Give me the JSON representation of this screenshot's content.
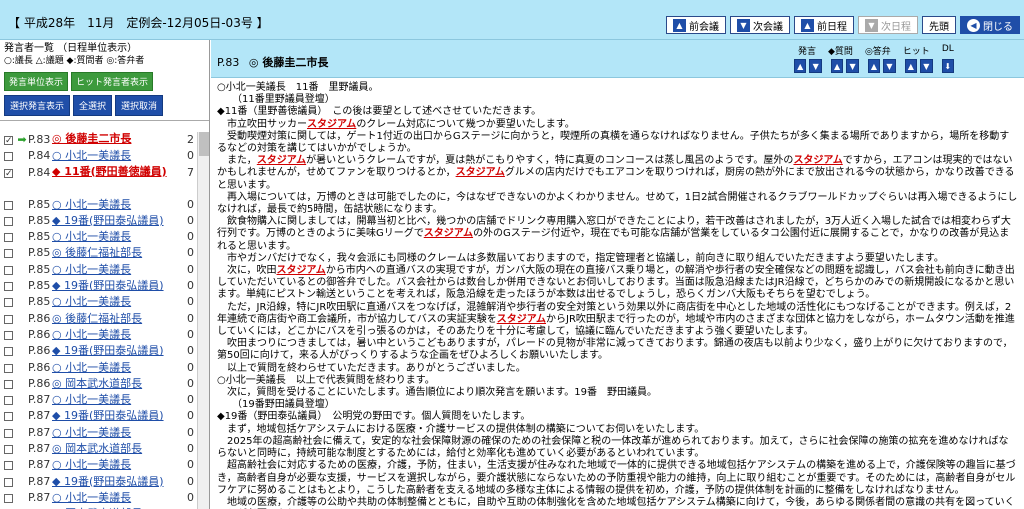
{
  "header": {
    "title": "【 平成28年　11月　定例会-12月05日-03号 】",
    "buttons": [
      {
        "label": "前会議",
        "icon": "up-arrow-icon",
        "state": "enabled"
      },
      {
        "label": "次会議",
        "icon": "down-arrow-icon",
        "state": "enabled"
      },
      {
        "label": "前日程",
        "icon": "up-arrow-icon",
        "state": "enabled"
      },
      {
        "label": "次日程",
        "icon": "down-arrow-icon",
        "state": "disabled"
      },
      {
        "label": "先頭",
        "icon": "",
        "state": "enabled"
      },
      {
        "label": "閉じる",
        "icon": "close-circle-icon",
        "state": "dark"
      }
    ]
  },
  "sidebar": {
    "heading": "発言者一覧 （日程単位表示）",
    "legend": "○:議長 △:議題 ◆:質問者 ◎:答弁者",
    "green_buttons": [
      "発言単位表示",
      "ヒット発言者表示"
    ],
    "blue_buttons": [
      "選択発言表示",
      "全選択",
      "選択取消"
    ],
    "rows": [
      {
        "checked": true,
        "current": true,
        "page": "P.83",
        "name": "◎ 後藤圭二市長",
        "count": "2",
        "highlight": true
      },
      {
        "checked": false,
        "current": false,
        "page": "P.84",
        "name": "○ 小北一美議長",
        "count": "0",
        "highlight": false
      },
      {
        "checked": true,
        "current": false,
        "page": "P.84",
        "name": "◆ 11番(野田善徳議員)",
        "count": "7",
        "highlight": true
      },
      {
        "checked": false,
        "current": false,
        "page": "P.85",
        "name": "○ 小北一美議長",
        "count": "0",
        "highlight": false
      },
      {
        "checked": false,
        "current": false,
        "page": "P.85",
        "name": "◆ 19番(野田泰弘議員)",
        "count": "0",
        "highlight": false
      },
      {
        "checked": false,
        "current": false,
        "page": "P.85",
        "name": "○ 小北一美議長",
        "count": "0",
        "highlight": false
      },
      {
        "checked": false,
        "current": false,
        "page": "P.85",
        "name": "◎ 後藤仁福祉部長",
        "count": "0",
        "highlight": false
      },
      {
        "checked": false,
        "current": false,
        "page": "P.85",
        "name": "○ 小北一美議長",
        "count": "0",
        "highlight": false
      },
      {
        "checked": false,
        "current": false,
        "page": "P.85",
        "name": "◆ 19番(野田泰弘議員)",
        "count": "0",
        "highlight": false
      },
      {
        "checked": false,
        "current": false,
        "page": "P.85",
        "name": "○ 小北一美議長",
        "count": "0",
        "highlight": false
      },
      {
        "checked": false,
        "current": false,
        "page": "P.86",
        "name": "◎ 後藤仁福祉部長",
        "count": "0",
        "highlight": false
      },
      {
        "checked": false,
        "current": false,
        "page": "P.86",
        "name": "○ 小北一美議長",
        "count": "0",
        "highlight": false
      },
      {
        "checked": false,
        "current": false,
        "page": "P.86",
        "name": "◆ 19番(野田泰弘議員)",
        "count": "0",
        "highlight": false
      },
      {
        "checked": false,
        "current": false,
        "page": "P.86",
        "name": "○ 小北一美議長",
        "count": "0",
        "highlight": false
      },
      {
        "checked": false,
        "current": false,
        "page": "P.86",
        "name": "◎ 岡本武水道部長",
        "count": "0",
        "highlight": false
      },
      {
        "checked": false,
        "current": false,
        "page": "P.87",
        "name": "○ 小北一美議長",
        "count": "0",
        "highlight": false
      },
      {
        "checked": false,
        "current": false,
        "page": "P.87",
        "name": "◆ 19番(野田泰弘議員)",
        "count": "0",
        "highlight": false
      },
      {
        "checked": false,
        "current": false,
        "page": "P.87",
        "name": "○ 小北一美議長",
        "count": "0",
        "highlight": false
      },
      {
        "checked": false,
        "current": false,
        "page": "P.87",
        "name": "◎ 岡本武水道部長",
        "count": "0",
        "highlight": false
      },
      {
        "checked": false,
        "current": false,
        "page": "P.87",
        "name": "○ 小北一美議長",
        "count": "0",
        "highlight": false
      },
      {
        "checked": false,
        "current": false,
        "page": "P.87",
        "name": "◆ 19番(野田泰弘議員)",
        "count": "0",
        "highlight": false
      },
      {
        "checked": false,
        "current": false,
        "page": "P.87",
        "name": "○ 小北一美議長",
        "count": "0",
        "highlight": false
      },
      {
        "checked": false,
        "current": false,
        "page": "P.87",
        "name": "◎ 岡本武水道部長",
        "count": "0",
        "highlight": false
      }
    ]
  },
  "main": {
    "page_label": "P.83",
    "speaker": "◎ 後藤圭二市長",
    "control_labels": [
      "発言",
      "◆質問",
      "◎答弁",
      "ヒット",
      "DL"
    ],
    "body": [
      "○小北一美議長　11番　里野議員。",
      "　　（11番里野議員登壇）",
      "◆11番（里野善徳議員）　この後は要望として述べさせていただきます。",
      "　市立吹田サッカー[スタジアム]のクレーム対応について幾つか要望いたします。",
      "　受動喫煙対策に関しては，ゲート1付近の出口からGステージに向かうと，喫煙所の真横を通らなければなりません。子供たちが多く集まる場所でありますから，場所を移動するなどの対策を講じてはいかがでしょうか。",
      "　また，[スタジアム]が暑いというクレームですが，夏は熱がこもりやすく，特に真夏のコンコースは蒸し風呂のようです。屋外の[スタジアム]ですから，エアコンは現実的ではないかもしれませんが，せめてファンを取りつけるとか，[スタジアム]グルメの店内だけでもエアコンを取りつければ，厨房の熱が外にまで放出される今の状態から，かなり改善できると思います。",
      "　再入場については，万博のときは可能でしたのに，今はなぜできないのかよくわかりません。せめて，1日2試合開催されるクラブワールドカップぐらいは再入場できるようにしなければ，最長で約5時間，缶詰状態になります。",
      "　飲食物購入に関しましては，開幕当初と比べ，幾つかの店舗でドリンク専用購入窓口ができたことにより，若干改善はされましたが，3万人近く入場した試合では相変わらず大行列です。万博のときのように美味Gリーグで[スタジアム]の外のGステージ付近や，現在でも可能な店舗が営業をしているタコ公園付近に展開することで，かなりの改善が見込まれると思います。",
      "　市やガンバだけでなく，我々会派にも同様のクレームは多数届いておりますので，指定管理者と協議し，前向きに取り組んでいただきますよう要望いたします。",
      "　次に，吹田[スタジアム]から市内への直通バスの実現ですが，ガンバ大阪の現在の直接バス乗り場と，の解消や歩行者の安全確保などの問題を認識し，バス会社も前向きに動き出していただいているとの御答弁でした。バス会社からは数台しか併用できないとお伺いしております。当面は阪急沿線またはJR沿線で，どちらかのみでの新規開設になるかと思います。単純にピストン輸送ということを考えれば，阪急沿線を走ったほうが本数は出せるでしょうし，恐らくガンバ大阪もそちらを望むでしょう。",
      "　ただ，JR沿線，特にJR吹田駅に直通バスをつなげば，混雑解消や歩行者の安全対策という効果以外に商店街を中心とした地域の活性化にもつなげることができます。例えば，2年連続で商店街や商工会議所，市が協力してバスの実証実験を[スタジアム]からJR吹田駅まで行ったのが，地域や市内のさまざまな団体と協力をしながら，ホームタウン活動を推進していくには，どこかにバスを引っ張るのかは，そのあたりを十分に考慮して，協議に臨んでいただきますよう強く要望いたします。",
      "　吹田まつりにつきましては，暑い中というこどもありますが，パレードの見物が非常に減ってきております。錦通の夜店も以前より少なく，盛り上がりに欠けておりますので，第50回に向けて，来る人がびっくりするような企画をぜひよろしくお願いいたします。",
      "　以上で質問を終わらせていただきます。ありがとうございました。",
      "○小北一美議長　以上で代表質問を終わります。",
      "　次に，質問を受けることにいたします。通告順位により順次発言を願います。19番　野田議員。",
      "　　（19番野田議員登壇）",
      "◆19番（野田泰弘議員）　公明党の野田です。個人質問をいたします。",
      "　まず，地域包括ケアシステムにおける医療・介護サービスの提供体制の構築についてお伺いをいたします。",
      "　2025年の超高齢社会に備えて，安定的な社会保障財源の確保のための社会保障と税の一体改革が進められております。加えて，さらに社会保障の施策の拡充を進めなければならないと同時に，持続可能な制度とするためには，給付と効率化も進めていく必要があるといわれています。",
      "　超高齢社会に対応するための医療，介護，予防，住まい，生活支援が住みなれた地域で一体的に提供できる地域包括ケアシステムの構築を進める上で，介護保険等の趣旨に基づき，高齢者自身が必要な支援，サービスを選択しながら，要介護状態にならないための予防重視や能力の維持，向上に取り組むことが重要です。そのためには，高齢者自身がセルフケアに努めることはもとより，こうした高齢者を支える地域の多様な主体による情報の提供を初め，介護，予防の提供体制を計画的に整備をしなければなりません。",
      "　地域の医療，介護等の公助や共助の体制整備とともに，自助や互助の体制強化を含めた地域包括ケアシステム構築に向けて，今後，あらゆる関係者間の意識の共有を図っていくことが必要であります。",
      "　その中で，平成26年4月28日に開催された第100回社会保障審議会介護給付費分科会の地域包括ケアシステムの資料の中に，はり師，きゅう師，あん摩マッサージ指圧師が明"
    ]
  }
}
